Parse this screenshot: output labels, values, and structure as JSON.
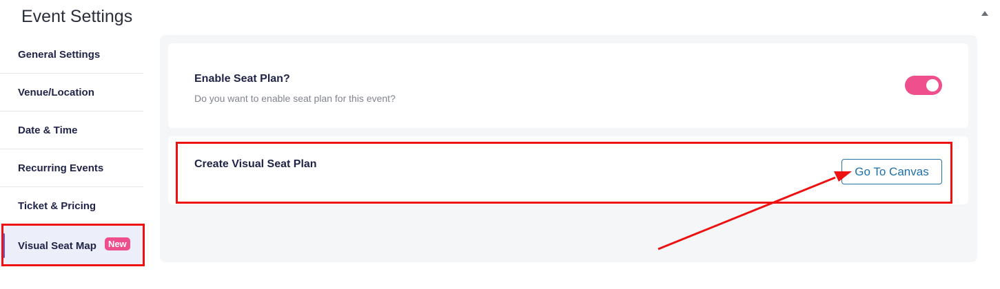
{
  "header": {
    "title": "Event Settings"
  },
  "sidebar": {
    "items": [
      {
        "label": "General Settings"
      },
      {
        "label": "Venue/Location"
      },
      {
        "label": "Date & Time"
      },
      {
        "label": "Recurring Events"
      },
      {
        "label": "Ticket & Pricing"
      },
      {
        "label": "Visual Seat Map",
        "badge": "New",
        "active": true
      }
    ]
  },
  "main": {
    "seat_plan": {
      "title": "Enable Seat Plan?",
      "description": "Do you want to enable seat plan for this event?",
      "enabled": true
    },
    "visual_plan": {
      "title": "Create Visual Seat Plan",
      "button_label": "Go To Canvas"
    }
  },
  "icons": {
    "collapse": "chevron-up-icon"
  },
  "colors": {
    "accent_pink": "#ef4f8d",
    "button_blue": "#1d6fa8",
    "highlight_red": "#ee1111",
    "active_indicator": "#5b5bd6"
  }
}
